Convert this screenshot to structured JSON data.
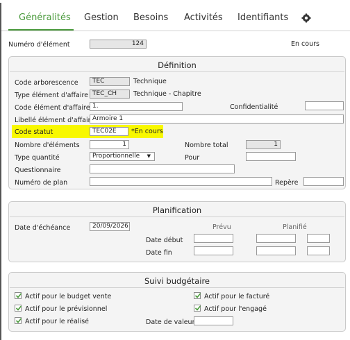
{
  "tabs": [
    {
      "label": "Généralités"
    },
    {
      "label": "Gestion"
    },
    {
      "label": "Besoins"
    },
    {
      "label": "Activités"
    },
    {
      "label": "Identifiants"
    }
  ],
  "top": {
    "numero_label": "Numéro d'élément",
    "numero_value": "124",
    "status_text": "En cours"
  },
  "definition": {
    "title": "Définition",
    "code_arbo_label": "Code arborescence",
    "code_arbo_value": "TEC",
    "code_arbo_desc": "Technique",
    "type_elem_label": "Type élément d'affaire",
    "type_elem_value": "TEC_CH",
    "type_elem_desc": "Technique - Chapitre",
    "code_elem_label": "Code élément d'affaire",
    "code_elem_value": "1.",
    "confid_label": "Confidentialité",
    "confid_value": "",
    "libelle_label": "Libellé élément d'affaire",
    "libelle_value": "Armoire 1",
    "code_statut_label": "Code statut",
    "code_statut_value": "TEC02E",
    "code_statut_desc": "*En cours",
    "nb_elem_label": "Nombre d'éléments",
    "nb_elem_value": "1",
    "nb_total_label": "Nombre total",
    "nb_total_value": "1",
    "type_qte_label": "Type quantité",
    "type_qte_value": "Proportionnelle",
    "pour_label": "Pour",
    "pour_value": "",
    "questionnaire_label": "Questionnaire",
    "questionnaire_value": "",
    "num_plan_label": "Numéro de plan",
    "num_plan_value": "",
    "repere_label": "Repère",
    "repere_value": ""
  },
  "planification": {
    "title": "Planification",
    "date_ech_label": "Date d'échéance",
    "date_ech_value": "20/09/2026",
    "prevu_label": "Prévu",
    "planifie_label": "Planifié",
    "date_debut_label": "Date début",
    "date_fin_label": "Date fin"
  },
  "budget": {
    "title": "Suivi budgétaire",
    "actif_vente": "Actif pour le budget vente",
    "actif_previsionnel": "Actif pour le prévisionnel",
    "actif_realise": "Actif pour le réalisé",
    "actif_facture": "Actif pour le facturé",
    "actif_engage": "Actif pour l'engagé",
    "date_valeur_label": "Date de valeur"
  },
  "colors": {
    "accent": "#4a9a3c",
    "highlight": "#f8f800"
  },
  "icons": {
    "settings": "gear-icon"
  }
}
